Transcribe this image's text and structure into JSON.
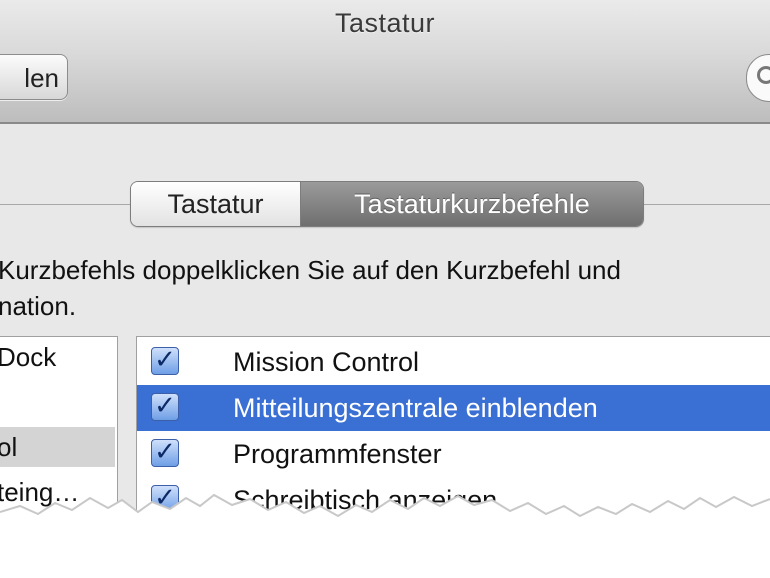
{
  "window": {
    "title": "Tastatur",
    "back_button_label": "len",
    "search_icon": "search-icon"
  },
  "tabs": [
    {
      "label": "Tastatur",
      "selected": false
    },
    {
      "label": "Tastaturkurzbefehle",
      "selected": true
    }
  ],
  "instruction": {
    "line1": "Kurzbefehls doppelklicken Sie auf den Kurzbefehl und",
    "line2": "nation."
  },
  "categories": [
    {
      "label": "Dock",
      "selected": false
    },
    {
      "label": "",
      "selected": false
    },
    {
      "label": "ol",
      "selected": true
    },
    {
      "label": "teing…",
      "selected": false
    }
  ],
  "shortcuts": [
    {
      "label": "Mission Control",
      "checked": true,
      "selected": false
    },
    {
      "label": "Mitteilungszentrale einblenden",
      "checked": true,
      "selected": true
    },
    {
      "label": "Programmfenster",
      "checked": true,
      "selected": false
    },
    {
      "label": "Schreibtisch anzeigen",
      "checked": true,
      "selected": false
    }
  ],
  "colors": {
    "selection": "#3a6fd4",
    "selected_tab": "#7f7f7f",
    "checkbox": "#6f9ee6"
  }
}
